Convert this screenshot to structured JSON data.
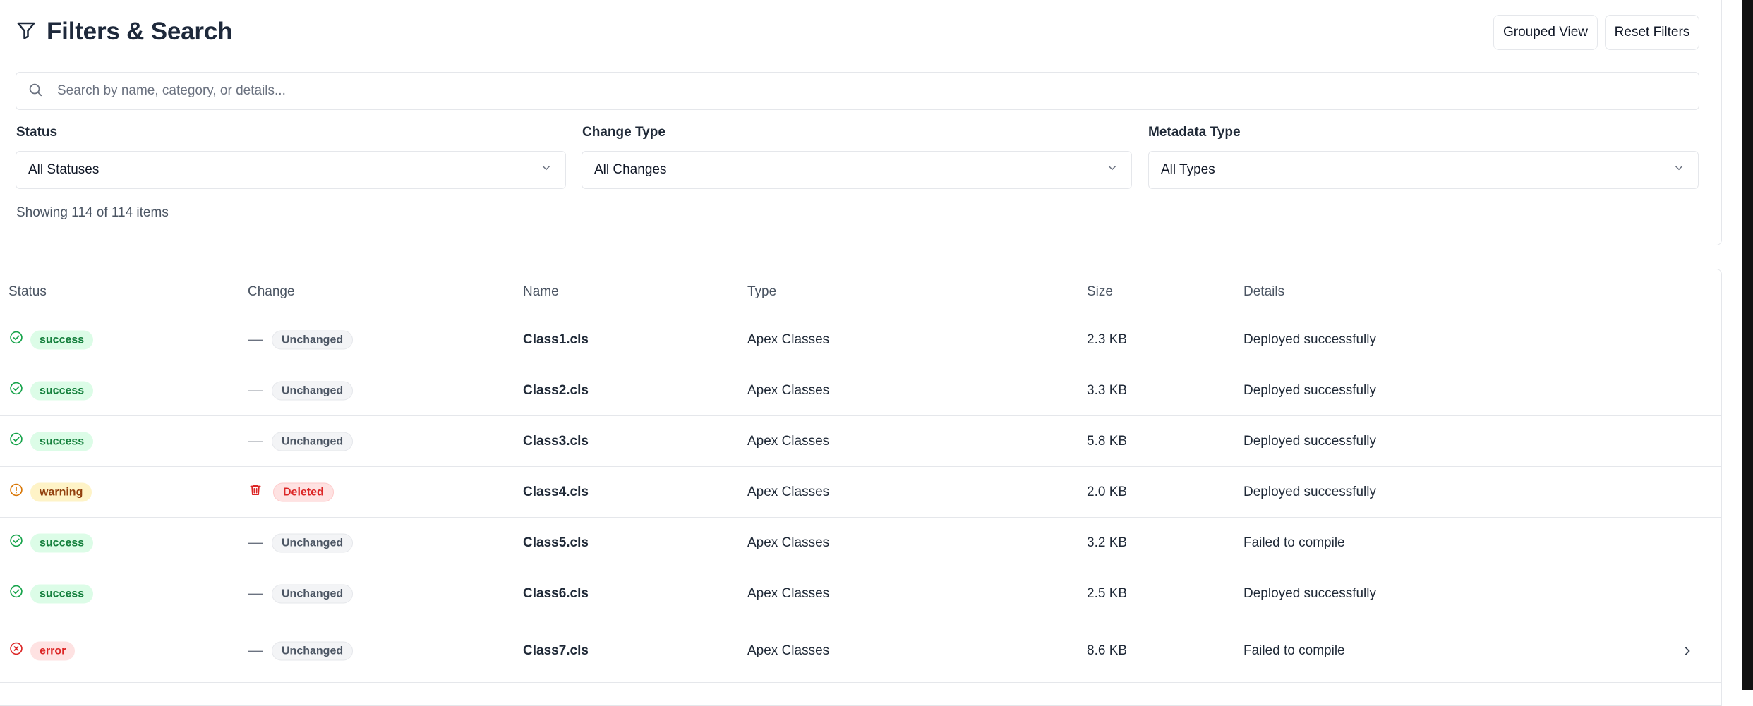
{
  "header": {
    "title": "Filters & Search",
    "grouped_view_label": "Grouped View",
    "reset_filters_label": "Reset Filters"
  },
  "search": {
    "placeholder": "Search by name, category, or details..."
  },
  "filters": {
    "status": {
      "label": "Status",
      "value": "All Statuses"
    },
    "change_type": {
      "label": "Change Type",
      "value": "All Changes"
    },
    "metadata_type": {
      "label": "Metadata Type",
      "value": "All Types"
    }
  },
  "summary": "Showing 114 of 114 items",
  "table": {
    "columns": [
      "Status",
      "Change",
      "Name",
      "Type",
      "Size",
      "Details"
    ],
    "rows": [
      {
        "status": "success",
        "change": "Unchanged",
        "name": "Class1.cls",
        "type": "Apex Classes",
        "size": "2.3 KB",
        "details": "Deployed successfully"
      },
      {
        "status": "success",
        "change": "Unchanged",
        "name": "Class2.cls",
        "type": "Apex Classes",
        "size": "3.3 KB",
        "details": "Deployed successfully"
      },
      {
        "status": "success",
        "change": "Unchanged",
        "name": "Class3.cls",
        "type": "Apex Classes",
        "size": "5.8 KB",
        "details": "Deployed successfully"
      },
      {
        "status": "warning",
        "change": "Deleted",
        "name": "Class4.cls",
        "type": "Apex Classes",
        "size": "2.0 KB",
        "details": "Deployed successfully"
      },
      {
        "status": "success",
        "change": "Unchanged",
        "name": "Class5.cls",
        "type": "Apex Classes",
        "size": "3.2 KB",
        "details": "Failed to compile"
      },
      {
        "status": "success",
        "change": "Unchanged",
        "name": "Class6.cls",
        "type": "Apex Classes",
        "size": "2.5 KB",
        "details": "Deployed successfully"
      },
      {
        "status": "error",
        "change": "Unchanged",
        "name": "Class7.cls",
        "type": "Apex Classes",
        "size": "8.6 KB",
        "details": "Failed to compile"
      }
    ]
  },
  "colors": {
    "success": "#16a34a",
    "warning": "#d97706",
    "error": "#dc2626",
    "deleted": "#dc2626",
    "border": "#e5e7eb"
  },
  "icons": {
    "title": "filter-icon",
    "search": "search-icon",
    "select": "chevron-down-icon",
    "success": "check-circle-icon",
    "warning": "alert-circle-icon",
    "error": "x-circle-icon",
    "unchanged": "minus-icon",
    "deleted": "trash-icon",
    "row_expand": "chevron-right-icon"
  }
}
